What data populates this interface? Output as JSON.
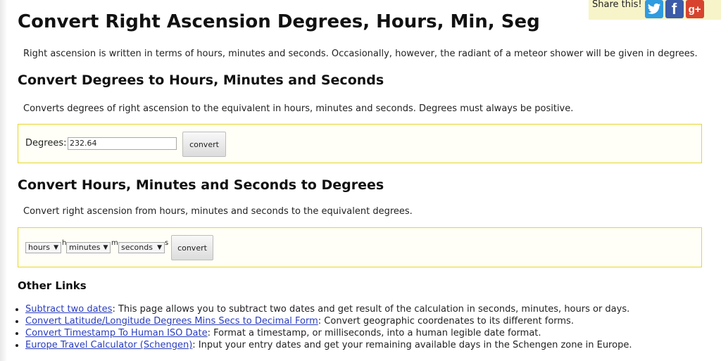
{
  "share": {
    "label": "Share this!",
    "twitter_icon": "twitter-icon",
    "facebook_icon": "facebook-icon",
    "googleplus_icon": "google-plus-icon",
    "facebook_glyph": "f",
    "googleplus_glyph": "g+"
  },
  "page": {
    "title": "Convert Right Ascension Degrees, Hours, Min, Seg",
    "intro": "Right ascension is written in terms of hours, minutes and seconds. Occasionally, however, the radiant of a meteor shower will be given in degrees."
  },
  "deg_to_hms": {
    "heading": "Convert Degrees to Hours, Minutes and Seconds",
    "description": "Converts degrees of right ascension to the equivalent in hours, minutes and seconds. Degrees must always be positive.",
    "degrees_label": "Degrees:",
    "degrees_value": "232.64",
    "convert_label": "convert"
  },
  "hms_to_deg": {
    "heading": "Convert Hours, Minutes and Seconds to Degrees",
    "description": "Convert right ascension from hours, minutes and seconds to the equivalent degrees.",
    "hours_select": "hours",
    "hours_unit": "h",
    "minutes_select": "minutes",
    "minutes_unit": "m",
    "seconds_select": "seconds",
    "seconds_unit": "s",
    "convert_label": "convert"
  },
  "other_links": {
    "heading": "Other Links",
    "items": [
      {
        "link": "Subtract two dates",
        "text": ": This page allows you to subtract two dates and get result of the calculation in seconds, minutes, hours or days."
      },
      {
        "link": "Convert Latitude/Longitude Degrees Mins Secs to Decimal Form",
        "text": ": Convert geographic coordenates to its different forms."
      },
      {
        "link": "Convert Timestamp To Human ISO Date",
        "text": ": Format a timestamp, or milliseconds, into a human legible date format."
      },
      {
        "link": "Europe Travel Calculator (Schengen)",
        "text": ": Input your entry dates and get your remaining available days in the Schengen zone in Europe."
      }
    ]
  }
}
